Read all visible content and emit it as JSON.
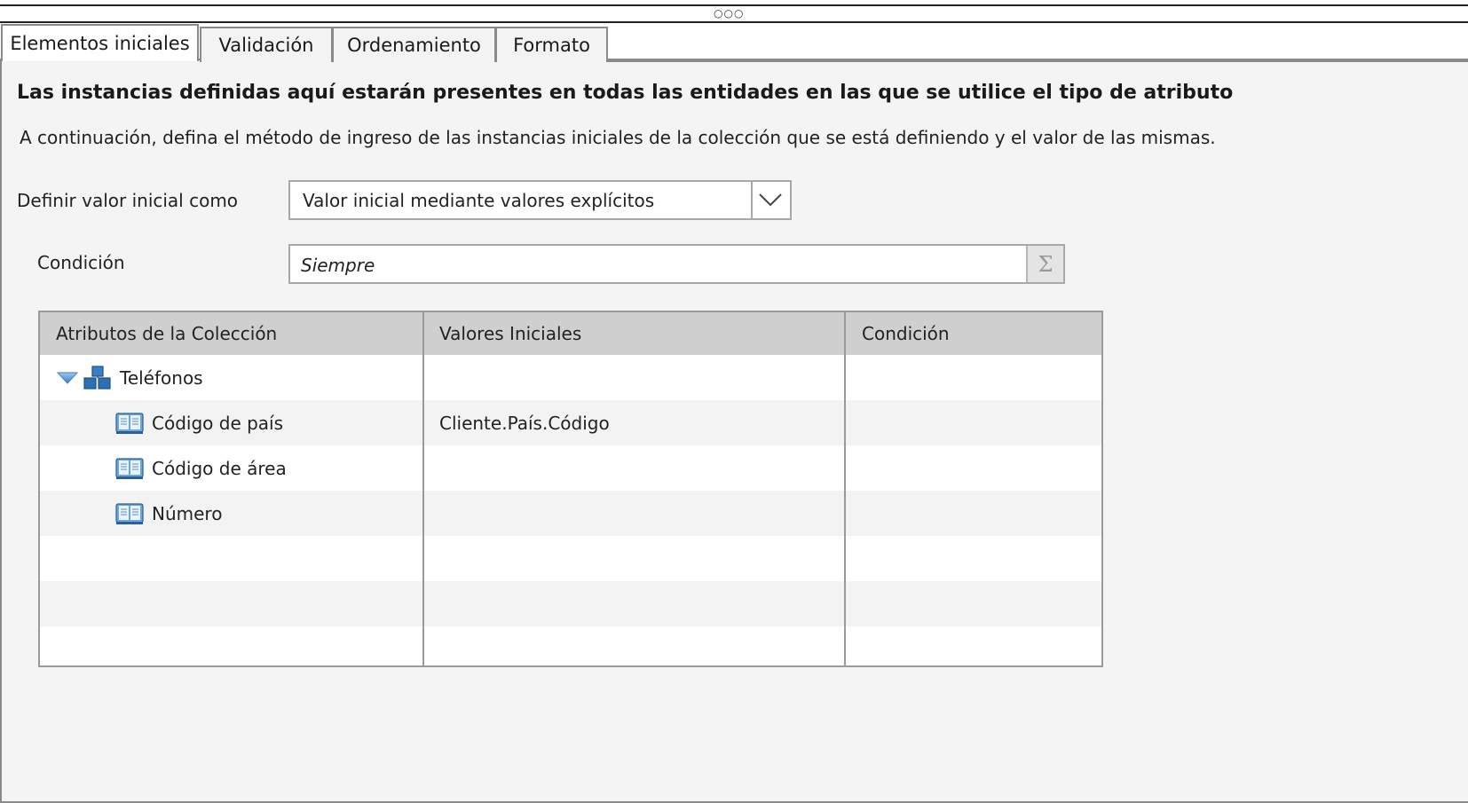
{
  "window": {
    "grip": "○○○"
  },
  "tabs": [
    {
      "label": "Elementos iniciales",
      "active": true
    },
    {
      "label": "Validación",
      "active": false
    },
    {
      "label": "Ordenamiento",
      "active": false
    },
    {
      "label": "Formato",
      "active": false
    }
  ],
  "panel": {
    "heading": "Las instancias definidas aquí estarán presentes en todas las entidades en las que se utilice el tipo de atributo",
    "description": "A continuación, defina el método de ingreso de las instancias iniciales de la colección que se está definiendo y el valor de las mismas.",
    "initial_value": {
      "label": "Definir valor inicial como",
      "selected": "Valor inicial mediante valores explícitos",
      "dropdown_icon": "chevron-down-icon"
    },
    "condition": {
      "label": "Condición",
      "value": "Siempre",
      "expression_icon": "sigma-icon",
      "expression_glyph": "Σ"
    }
  },
  "grid": {
    "columns": [
      "Atributos de la Colección",
      "Valores Iniciales",
      "Condición"
    ],
    "rows": [
      {
        "attribute": "Teléfonos",
        "value": "",
        "condition": "",
        "icon": "collection-icon",
        "expanded": true,
        "level": 0
      },
      {
        "attribute": "Código de país",
        "value": "Cliente.País.Código",
        "condition": "",
        "icon": "book-icon",
        "level": 1
      },
      {
        "attribute": "Código de área",
        "value": "",
        "condition": "",
        "icon": "book-icon",
        "level": 1
      },
      {
        "attribute": "Número",
        "value": "",
        "condition": "",
        "icon": "book-icon",
        "level": 1
      },
      {
        "attribute": "",
        "value": "",
        "condition": "",
        "level": 1
      },
      {
        "attribute": "",
        "value": "",
        "condition": "",
        "level": 1
      },
      {
        "attribute": "",
        "value": "",
        "condition": "",
        "level": 1
      }
    ]
  }
}
